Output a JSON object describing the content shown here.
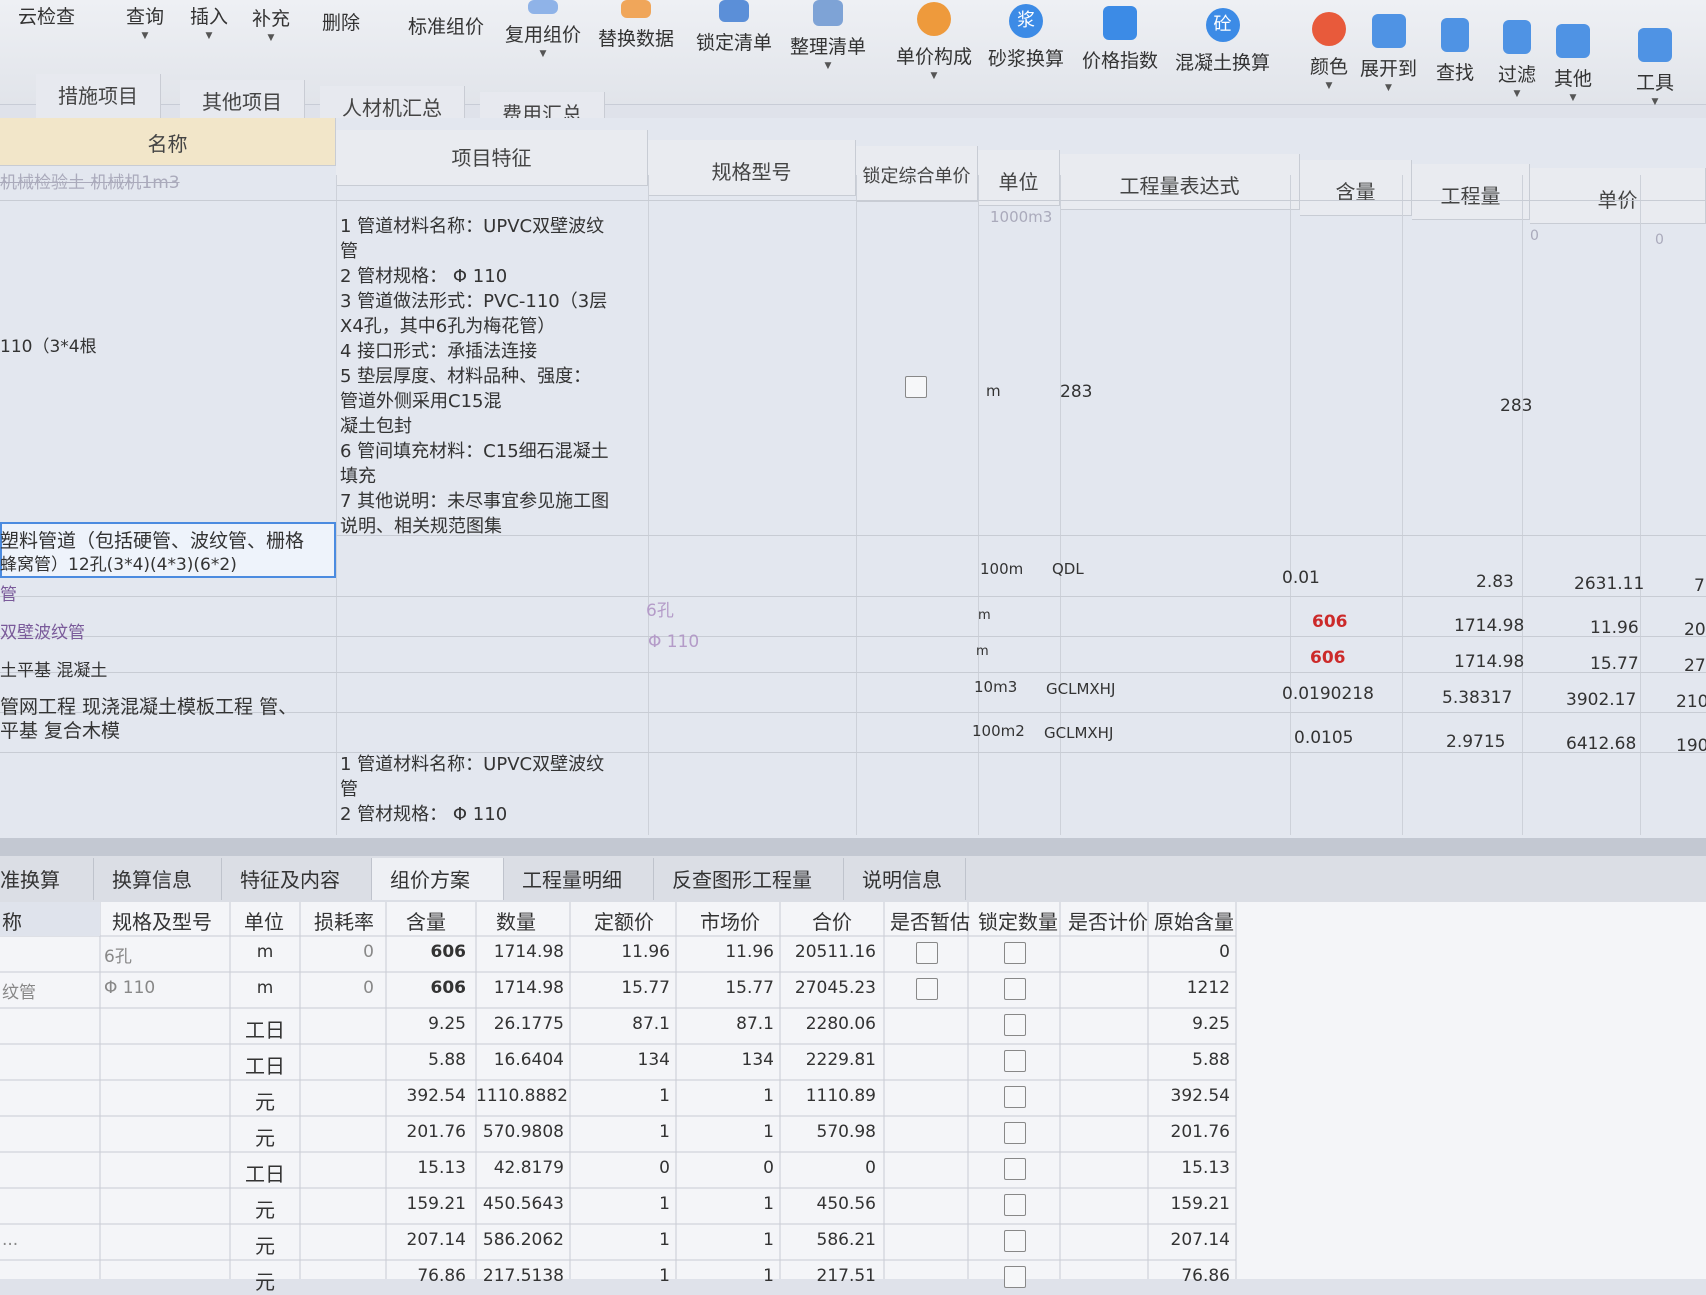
{
  "toolbar": {
    "items": [
      {
        "label": "云检查",
        "icon": "cloud-check-icon"
      },
      {
        "label": "查询",
        "icon": "query-icon"
      },
      {
        "label": "插入",
        "icon": "insert-icon"
      },
      {
        "label": "补充",
        "icon": "supplement-icon"
      },
      {
        "label": "删除",
        "icon": "delete-icon"
      },
      {
        "label": "标准组价",
        "icon": "standard-pricing-icon"
      },
      {
        "label": "复用组价",
        "icon": "reuse-pricing-icon"
      },
      {
        "label": "替换数据",
        "icon": "replace-data-icon"
      },
      {
        "label": "锁定清单",
        "icon": "lock-list-icon"
      },
      {
        "label": "整理清单",
        "icon": "organize-list-icon"
      },
      {
        "label": "单价构成",
        "icon": "unit-price-icon"
      },
      {
        "label": "砂浆换算",
        "icon": "mortar-convert-icon"
      },
      {
        "label": "价格指数",
        "icon": "price-index-icon"
      },
      {
        "label": "混凝土换算",
        "icon": "concrete-convert-icon"
      },
      {
        "label": "颜色",
        "icon": "color-icon"
      },
      {
        "label": "展开到",
        "icon": "expand-icon"
      },
      {
        "label": "查找",
        "icon": "find-icon"
      },
      {
        "label": "过滤",
        "icon": "filter-icon"
      },
      {
        "label": "其他",
        "icon": "other-icon"
      },
      {
        "label": "工具",
        "icon": "tools-icon"
      }
    ]
  },
  "tabs_top": [
    "措施项目",
    "其他项目",
    "人材机汇总",
    "费用汇总"
  ],
  "grid_top": {
    "headers": {
      "name": "名称",
      "feature": "项目特征",
      "spec": "规格型号",
      "lock": "锁定综合单价",
      "unit": "单位",
      "expr": "工程量表达式",
      "content": "含量",
      "qty": "工程量",
      "price": "单价"
    },
    "row0": {
      "name": "机械检验土 机械机1m3",
      "unit": "1000m3",
      "qty": "0",
      "price": "0"
    },
    "row1": {
      "name": "110（3*4根",
      "features": [
        "1 管道材料名称：UPVC双壁波纹",
        "管",
        "2 管材规格： Φ 110",
        "3 管道做法形式：PVC-110（3层",
        "X4孔，其中6孔为梅花管）",
        "4 接口形式：承插法连接",
        "5 垫层厚度、材料品种、强度：",
        "管道外侧采用C15混",
        "凝土包封",
        "6 管间填充材料：C15细石混凝土",
        "填充",
        "7 其他说明：未尽事宜参见施工图",
        "说明、相关规范图集"
      ],
      "unit": "m",
      "expr": "283",
      "qty": "283"
    },
    "row2": {
      "name1": "塑料管道（包括硬管、波纹管、栅格",
      "name2": "蜂窝管）12孔(3*4)(4*3)(6*2)",
      "unit": "100m",
      "expr": "QDL",
      "content": "0.01",
      "qty": "2.83",
      "price": "2631.11",
      "extra": "7"
    },
    "row3": {
      "name": "管",
      "spec": "6孔",
      "unit": "m",
      "content": "606",
      "qty": "1714.98",
      "price": "11.96",
      "extra": "20"
    },
    "row4": {
      "name": "双壁波纹管",
      "spec": "Φ 110",
      "unit": "m",
      "content": "606",
      "qty": "1714.98",
      "price": "15.77",
      "extra": "27"
    },
    "row5": {
      "name": "土平基 混凝土",
      "unit": "10m3",
      "expr": "GCLMXHJ",
      "content": "0.0190218",
      "qty": "5.38317",
      "price": "3902.17",
      "extra": "210"
    },
    "row6": {
      "name1": "管网工程 现浇混凝土模板工程 管、",
      "name2": "平基 复合木模",
      "unit": "100m2",
      "expr": "GCLMXHJ",
      "content": "0.0105",
      "qty": "2.9715",
      "price": "6412.68",
      "extra": "190"
    },
    "row7": {
      "features": [
        "1 管道材料名称：UPVC双壁波纹",
        "管",
        "2 管材规格： Φ 110"
      ]
    }
  },
  "tabs_bottom": [
    "准换算",
    "换算信息",
    "特征及内容",
    "组价方案",
    "工程量明细",
    "反查图形工程量",
    "说明信息"
  ],
  "grid_bottom": {
    "headers": [
      "称",
      "规格及型号",
      "单位",
      "损耗率",
      "含量",
      "数量",
      "定额价",
      "市场价",
      "合价",
      "是否暂估",
      "锁定数量",
      "是否计价",
      "原始含量"
    ],
    "rows": [
      {
        "name": "",
        "spec": "6孔",
        "unit": "m",
        "loss": "0",
        "content": "606",
        "qty": "1714.98",
        "quota": "11.96",
        "market": "11.96",
        "total": "20511.16",
        "orig": "0",
        "est": true
      },
      {
        "name": "纹管",
        "spec": "Φ 110",
        "unit": "m",
        "loss": "0",
        "content": "606",
        "qty": "1714.98",
        "quota": "15.77",
        "market": "15.77",
        "total": "27045.23",
        "orig": "1212",
        "est": true
      },
      {
        "name": "",
        "spec": "",
        "unit": "工日",
        "loss": "",
        "content": "9.25",
        "qty": "26.1775",
        "quota": "87.1",
        "market": "87.1",
        "total": "2280.06",
        "orig": "9.25",
        "est": false
      },
      {
        "name": "",
        "spec": "",
        "unit": "工日",
        "loss": "",
        "content": "5.88",
        "qty": "16.6404",
        "quota": "134",
        "market": "134",
        "total": "2229.81",
        "orig": "5.88",
        "est": false
      },
      {
        "name": "",
        "spec": "",
        "unit": "元",
        "loss": "",
        "content": "392.54",
        "qty": "1110.8882",
        "quota": "1",
        "market": "1",
        "total": "1110.89",
        "orig": "392.54",
        "est": false
      },
      {
        "name": "",
        "spec": "",
        "unit": "元",
        "loss": "",
        "content": "201.76",
        "qty": "570.9808",
        "quota": "1",
        "market": "1",
        "total": "570.98",
        "orig": "201.76",
        "est": false
      },
      {
        "name": "",
        "spec": "",
        "unit": "工日",
        "loss": "",
        "content": "15.13",
        "qty": "42.8179",
        "quota": "0",
        "market": "0",
        "total": "0",
        "orig": "15.13",
        "est": false
      },
      {
        "name": "",
        "spec": "",
        "unit": "元",
        "loss": "",
        "content": "159.21",
        "qty": "450.5643",
        "quota": "1",
        "market": "1",
        "total": "450.56",
        "orig": "159.21",
        "est": false
      },
      {
        "name": "...",
        "spec": "",
        "unit": "元",
        "loss": "",
        "content": "207.14",
        "qty": "586.2062",
        "quota": "1",
        "market": "1",
        "total": "586.21",
        "orig": "207.14",
        "est": false
      },
      {
        "name": "",
        "spec": "",
        "unit": "元",
        "loss": "",
        "content": "76.86",
        "qty": "217.5138",
        "quota": "1",
        "market": "1",
        "total": "217.51",
        "orig": "76.86",
        "est": false
      }
    ]
  }
}
